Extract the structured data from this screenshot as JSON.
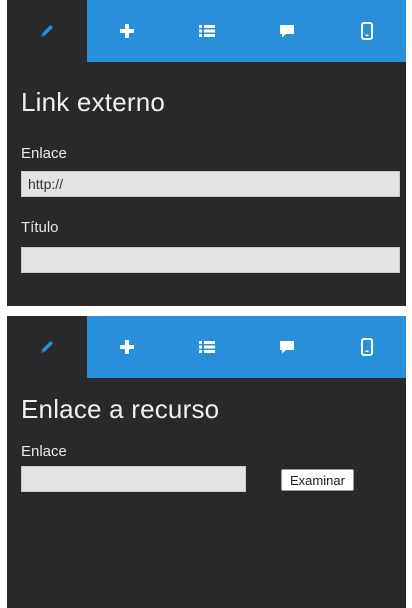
{
  "panel_external_link": {
    "title": "Link externo",
    "link_label": "Enlace",
    "link_value": "http://",
    "title_label": "Título",
    "title_value": ""
  },
  "panel_resource_link": {
    "title": "Enlace a recurso",
    "link_label": "Enlace",
    "link_value": "",
    "browse_button": "Examinar"
  },
  "tabs": [
    {
      "icon": "pencil-icon",
      "active": true
    },
    {
      "icon": "plus-icon",
      "active": false
    },
    {
      "icon": "list-icon",
      "active": false
    },
    {
      "icon": "speech-bubble-icon",
      "active": false
    },
    {
      "icon": "mobile-phone-icon",
      "active": false
    }
  ],
  "colors": {
    "panel_background": "#29292c",
    "tab_bar": "#2a8fdb",
    "active_icon": "#2a8fdb",
    "inactive_icon": "#ffffff",
    "input_background": "#e3e3e3"
  }
}
